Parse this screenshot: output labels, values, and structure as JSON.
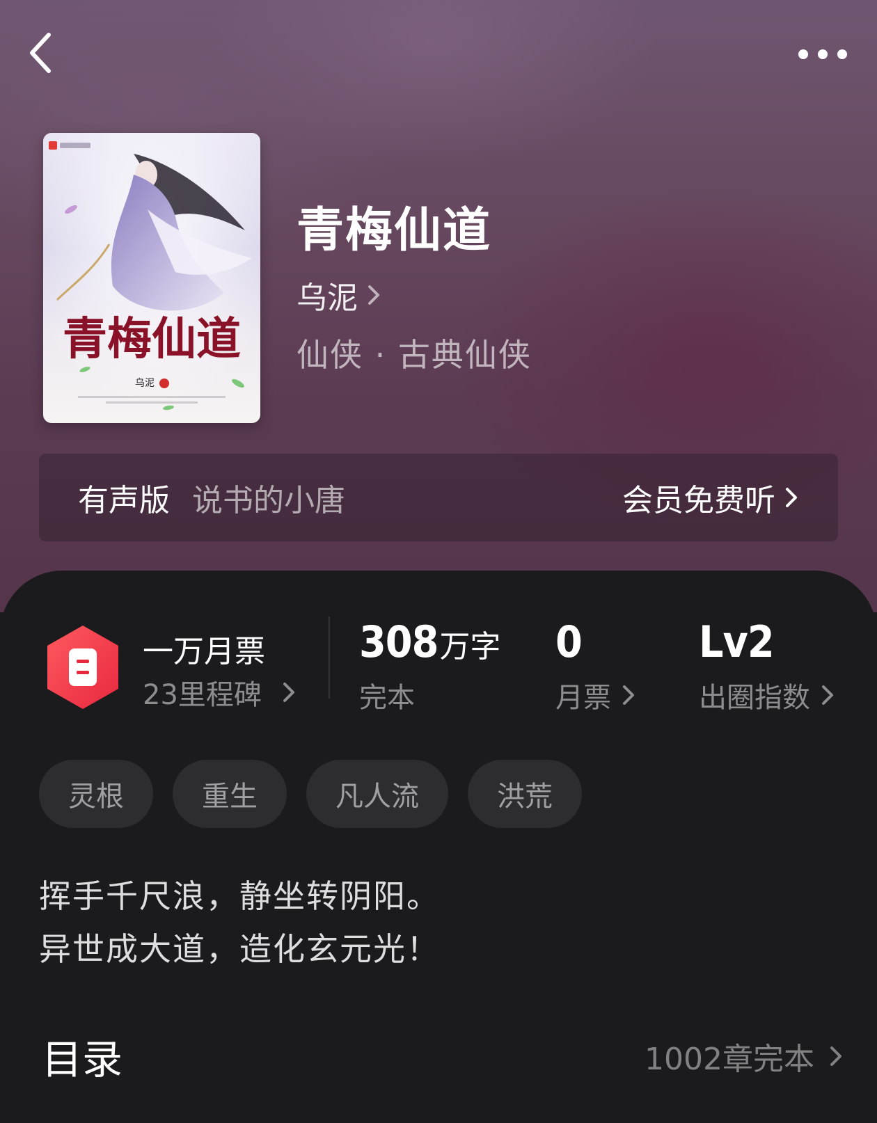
{
  "header": {
    "back_icon": "chevron-left-icon",
    "more_icon": "more-dots-icon"
  },
  "book": {
    "title": "青梅仙道",
    "author": "乌泥",
    "genre": "仙侠 · 古典仙侠",
    "cover": {
      "title_art": "青梅仙道",
      "author_art": "乌泥"
    }
  },
  "audio": {
    "label": "有声版",
    "narrator": "说书的小唐",
    "action": "会员免费听"
  },
  "stats": {
    "ticket": {
      "title": "一万月票",
      "subtitle": "23里程碑"
    },
    "words": {
      "value": "308",
      "unit": "万字",
      "label": "完本"
    },
    "votes": {
      "value": "0",
      "label": "月票"
    },
    "level": {
      "value": "Lv2",
      "label": "出圈指数"
    }
  },
  "tags": [
    "灵根",
    "重生",
    "凡人流",
    "洪荒"
  ],
  "synopsis": [
    "挥手千尺浪，静坐转阴阳。",
    "异世成大道，造化玄元光！"
  ],
  "toc": {
    "title": "目录",
    "status": "1002章完本"
  },
  "colors": {
    "accent_red": "#ee3c4a",
    "sheet_bg": "#1b1a1c",
    "hero_bg": "#66485f",
    "tag_bg": "#2d2c2f"
  }
}
